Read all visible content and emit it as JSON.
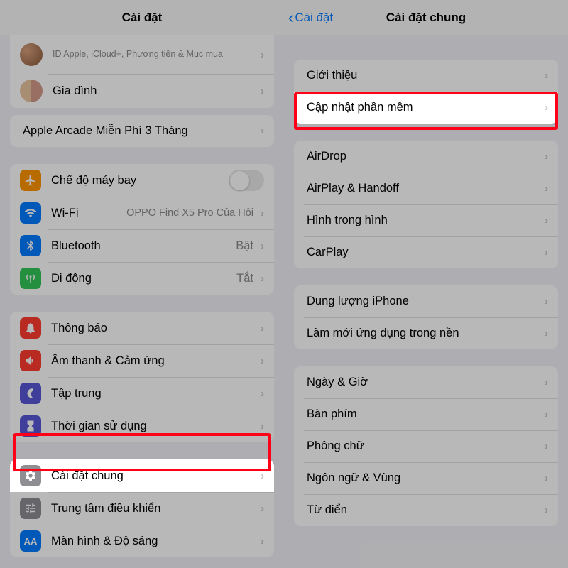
{
  "left": {
    "title": "Cài đặt",
    "appleid_sub": "ID Apple, iCloud+, Phương tiện & Mục mua",
    "family_label": "Gia đình",
    "arcade": "Apple Arcade Miễn Phí 3 Tháng",
    "airplane": "Chế độ máy bay",
    "wifi_label": "Wi-Fi",
    "wifi_value": "OPPO Find X5 Pro Của Hội",
    "bluetooth_label": "Bluetooth",
    "bluetooth_value": "Bật",
    "cellular_label": "Di động",
    "cellular_value": "Tắt",
    "notifications": "Thông báo",
    "sound": "Âm thanh & Cảm ứng",
    "focus": "Tập trung",
    "screentime": "Thời gian sử dụng",
    "general": "Cài đặt chung",
    "controlcenter": "Trung tâm điều khiển",
    "display": "Màn hình & Độ sáng"
  },
  "right": {
    "back": "Cài đặt",
    "title": "Cài đặt chung",
    "about": "Giới thiệu",
    "software_update": "Cập nhật phần mềm",
    "airdrop": "AirDrop",
    "airplay": "AirPlay & Handoff",
    "pip": "Hình trong hình",
    "carplay": "CarPlay",
    "storage": "Dung lượng iPhone",
    "background_refresh": "Làm mới ứng dụng trong nền",
    "datetime": "Ngày & Giờ",
    "keyboard": "Bàn phím",
    "fonts": "Phông chữ",
    "language": "Ngôn ngữ & Vùng",
    "dictionary": "Từ điển"
  },
  "colors": {
    "airplane": "#ff9500",
    "wifi": "#007aff",
    "bluetooth": "#007aff",
    "cellular": "#34c759",
    "notifications": "#ff3b30",
    "sound": "#ff3b30",
    "focus": "#5856d6",
    "screentime": "#5856d6",
    "general": "#8e8e93",
    "controlcenter": "#8e8e93",
    "display": "#007aff"
  }
}
